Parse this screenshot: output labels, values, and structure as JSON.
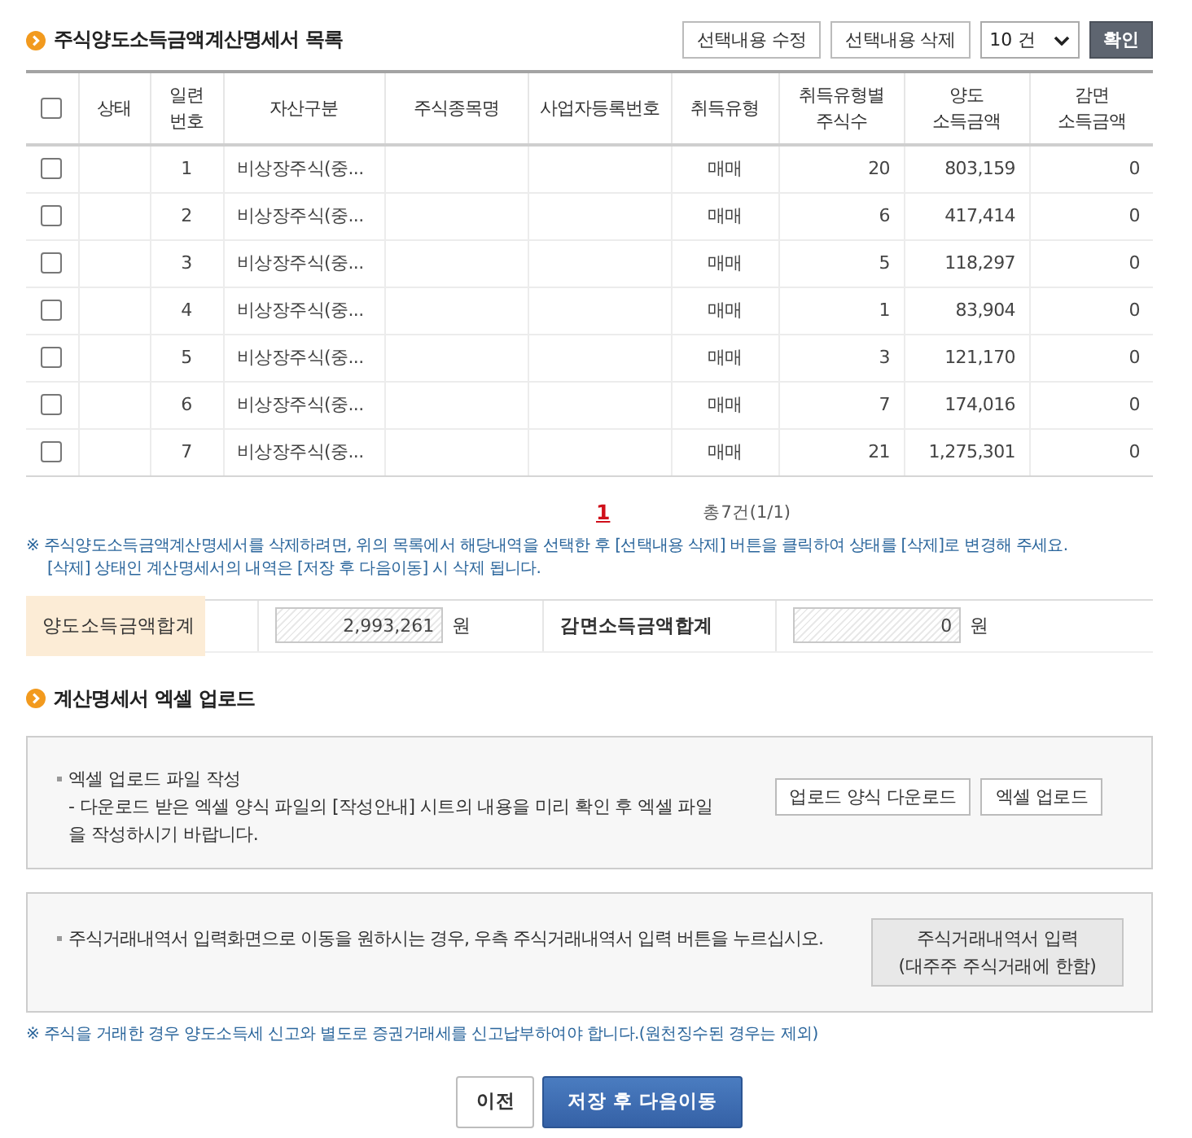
{
  "list_section": {
    "title": "주식양도소득금액계산명세서 목록",
    "actions": [
      {
        "kind": "button",
        "label": "선택내용 수정"
      },
      {
        "kind": "button",
        "label": "선택내용 삭제"
      },
      {
        "kind": "select",
        "value": "10 건"
      },
      {
        "kind": "confirm",
        "label": "확인"
      }
    ]
  },
  "table": {
    "select_all_checked": false,
    "columns": [
      "상태",
      "일련\n번호",
      "자산구분",
      "주식종목명",
      "사업자등록번호",
      "취득유형",
      "취득유형별\n주식수",
      "양도\n소득금액",
      "감면\n소득금액"
    ],
    "rows": [
      {
        "checked": false,
        "serial_no": "1",
        "asset_type": "비상장주식(중...",
        "acquisition_type": "매매",
        "shares": "20",
        "transfer_income": "803,159",
        "exempt_income": "0"
      },
      {
        "checked": false,
        "serial_no": "2",
        "asset_type": "비상장주식(중...",
        "acquisition_type": "매매",
        "shares": "6",
        "transfer_income": "417,414",
        "exempt_income": "0"
      },
      {
        "checked": false,
        "serial_no": "3",
        "asset_type": "비상장주식(중...",
        "acquisition_type": "매매",
        "shares": "5",
        "transfer_income": "118,297",
        "exempt_income": "0"
      },
      {
        "checked": false,
        "serial_no": "4",
        "asset_type": "비상장주식(중...",
        "acquisition_type": "매매",
        "shares": "1",
        "transfer_income": "83,904",
        "exempt_income": "0"
      },
      {
        "checked": false,
        "serial_no": "5",
        "asset_type": "비상장주식(중...",
        "acquisition_type": "매매",
        "shares": "3",
        "transfer_income": "121,170",
        "exempt_income": "0"
      },
      {
        "checked": false,
        "serial_no": "6",
        "asset_type": "비상장주식(중...",
        "acquisition_type": "매매",
        "shares": "7",
        "transfer_income": "174,016",
        "exempt_income": "0"
      },
      {
        "checked": false,
        "serial_no": "7",
        "asset_type": "비상장주식(중...",
        "acquisition_type": "매매",
        "shares": "21",
        "transfer_income": "1,275,301",
        "exempt_income": "0"
      }
    ]
  },
  "pagination": {
    "pages": [
      {
        "label": "1",
        "selected": true
      }
    ],
    "summary": "총7건(1/1)"
  },
  "delete_note": [
    "※ 주식양도소득금액계산명세서를 삭제하려면, 위의 목록에서 해당내역을 선택한 후 [선택내용 삭제] 버튼을 클릭하여 상태를 [삭제]로 변경해 주세요.",
    "[삭제] 상태인 계산명세서의 내역은 [저장 후 다음이동] 시 삭제 됩니다."
  ],
  "totals": [
    {
      "label": "양도소득금액합계",
      "value": "2,993,261",
      "unit": "원",
      "highlighted": true
    },
    {
      "label": "감면소득금액합계",
      "value": "0",
      "unit": "원",
      "highlighted": false
    }
  ],
  "excel_upload": {
    "title": "계산명세서 엑셀 업로드",
    "heading": "엑셀 업로드 파일 작성",
    "description": "- 다운로드 받은 엑셀 양식 파일의 [작성안내] 시트의 내용을 미리 확인 후 엑셀 파일을 작성하시기 바랍니다.",
    "buttons": [
      "업로드 양식 다운로드",
      "엑셀 업로드"
    ]
  },
  "trade_entry": {
    "text": "주식거래내역서 입력화면으로 이동을 원하시는 경우, 우측 주식거래내역서 입력 버튼을 누르십시오.",
    "button_lines": [
      "주식거래내역서 입력",
      "(대주주 주식거래에 한함)"
    ]
  },
  "tax_note": "※ 주식을 거래한 경우 양도소득세 신고와 별도로 증권거래세를 신고납부하여야 합니다.(원천징수된 경우는 제외)",
  "nav_buttons": [
    {
      "kind": "secondary",
      "label": "이전"
    },
    {
      "kind": "primary",
      "label": "저장 후 다음이동"
    }
  ]
}
